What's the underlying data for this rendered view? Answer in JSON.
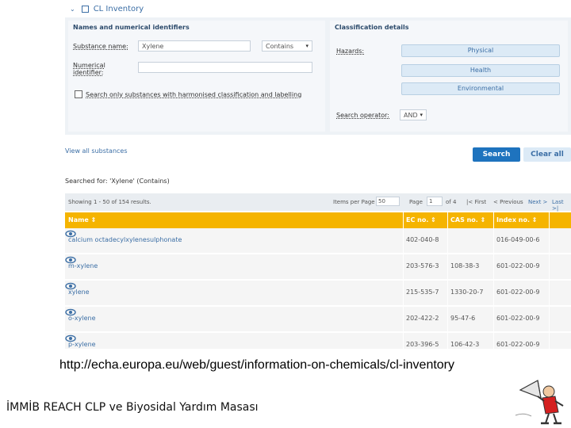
{
  "inventory": {
    "title": "CL Inventory"
  },
  "names_section": {
    "title": "Names and numerical identifiers",
    "substance_label": "Substance name:",
    "substance_value": "Xylene",
    "operator_value": "Contains",
    "numerical_label": "Numerical identifier:",
    "harmonised_label": "Search only substances with harmonised classification and labelling"
  },
  "classification": {
    "title": "Classification details",
    "hazards_label": "Hazards:",
    "physical": "Physical",
    "health": "Health",
    "environmental": "Environmental",
    "search_operator_label": "Search operator:",
    "search_operator_value": "AND"
  },
  "actions": {
    "view_all": "View all substances",
    "search": "Search",
    "clear_all": "Clear all"
  },
  "results": {
    "searched_for": "Searched for: 'Xylene' (Contains)",
    "showing": "Showing 1 - 50 of 154 results.",
    "items_per_page_label": "Items per Page",
    "items_per_page": "50",
    "page_label": "Page",
    "page": "1",
    "page_total": "of 4",
    "first": "|< First",
    "previous": "< Previous",
    "next": "Next >",
    "last": "Last >|",
    "columns": {
      "name": "Name",
      "ec": "EC no.",
      "cas": "CAS no.",
      "index": "Index no."
    },
    "rows": [
      {
        "name": "calcium octadecylxylenesulphonate",
        "ec": "402-040-8",
        "cas": "",
        "index": "016-049-00-6"
      },
      {
        "name": "m-xylene",
        "ec": "203-576-3",
        "cas": "108-38-3",
        "index": "601-022-00-9"
      },
      {
        "name": "xylene",
        "ec": "215-535-7",
        "cas": "1330-20-7",
        "index": "601-022-00-9"
      },
      {
        "name": "o-xylene",
        "ec": "202-422-2",
        "cas": "95-47-6",
        "index": "601-022-00-9"
      },
      {
        "name": "p-xylene",
        "ec": "203-396-5",
        "cas": "106-42-3",
        "index": "601-022-00-9"
      }
    ]
  },
  "caption": {
    "url": "http://echa.europa.eu/web/guest/information-on-chemicals/cl-inventory"
  },
  "footer": {
    "text": "İMMİB REACH CLP ve Biyosidal Yardım Masası"
  },
  "colors": {
    "accent": "#1e73be",
    "table_header": "#f5b400",
    "link": "#3b6ea5"
  }
}
